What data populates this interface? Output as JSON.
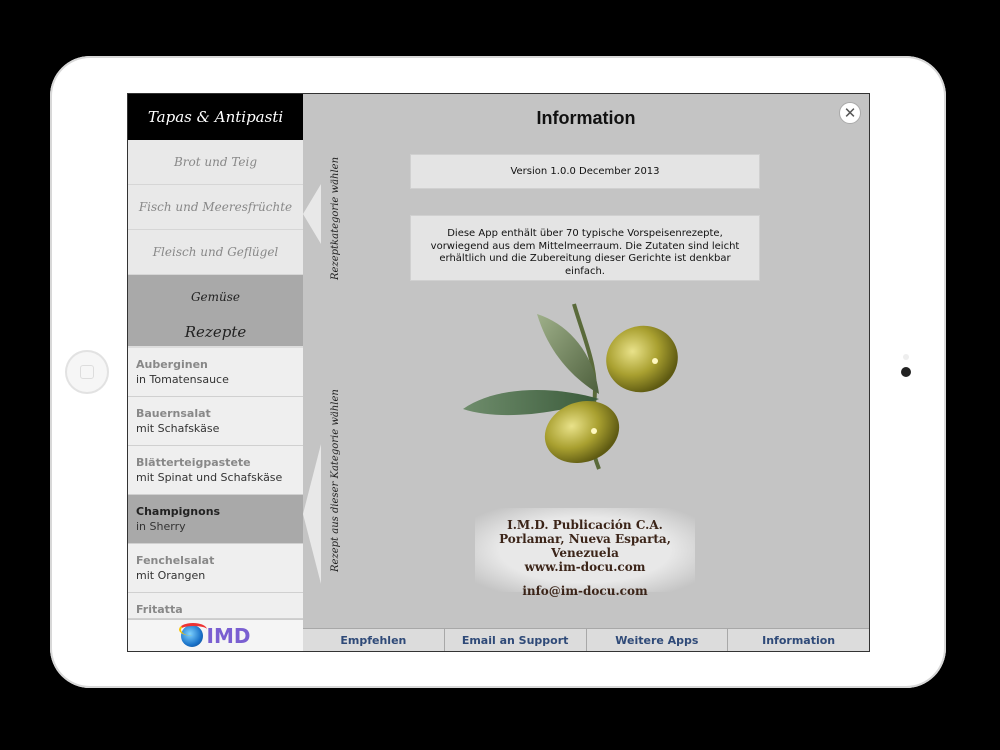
{
  "sidebar": {
    "title": "Tapas & Antipasti",
    "categories": [
      {
        "label": "Brot und Teig"
      },
      {
        "label": "Fisch und Meeresfrüchte"
      },
      {
        "label": "Fleisch und Geflügel"
      },
      {
        "label": "Gemüse"
      }
    ],
    "recipes_header": "Rezepte",
    "recipes": [
      {
        "title": "Auberginen",
        "subtitle": "in Tomatensauce"
      },
      {
        "title": "Bauernsalat",
        "subtitle": "mit Schafskäse"
      },
      {
        "title": "Blätterteigpastete",
        "subtitle": "mit Spinat und Schafskäse"
      },
      {
        "title": "Champignons",
        "subtitle": "in Sherry"
      },
      {
        "title": "Fenchelsalat",
        "subtitle": "mit Orangen"
      },
      {
        "title": "Fritatta",
        "subtitle": ""
      }
    ],
    "logo_text": "IMD"
  },
  "main": {
    "vertical_labels": {
      "category": "Rezeptkategorie wählen",
      "recipe": "Rezept aus dieser Kategorie wählen"
    },
    "title": "Information",
    "close_symbol": "✕",
    "version": "Version 1.0.0 December 2013",
    "description": "Diese App enthält über 70 typische Vorspeisenrezepte, vorwiegend aus dem Mittelmeerraum. Die Zutaten sind leicht erhältlich und die Zubereitung dieser Gerichte ist denkbar einfach.",
    "address": {
      "line1": "I.M.D. Publicación C.A.",
      "line2": "Porlamar, Nueva Esparta, Venezuela",
      "line3": "www.im-docu.com",
      "email": "info@im-docu.com"
    }
  },
  "tabs": [
    {
      "label": "Empfehlen"
    },
    {
      "label": "Email an Support"
    },
    {
      "label": "Weitere Apps"
    },
    {
      "label": "Information"
    }
  ],
  "colors": {
    "sidebar_selected": "#a9a9a9",
    "main_bg": "#c4c4c4",
    "tab_text": "#2f4a78",
    "address_text": "#3b2418"
  }
}
